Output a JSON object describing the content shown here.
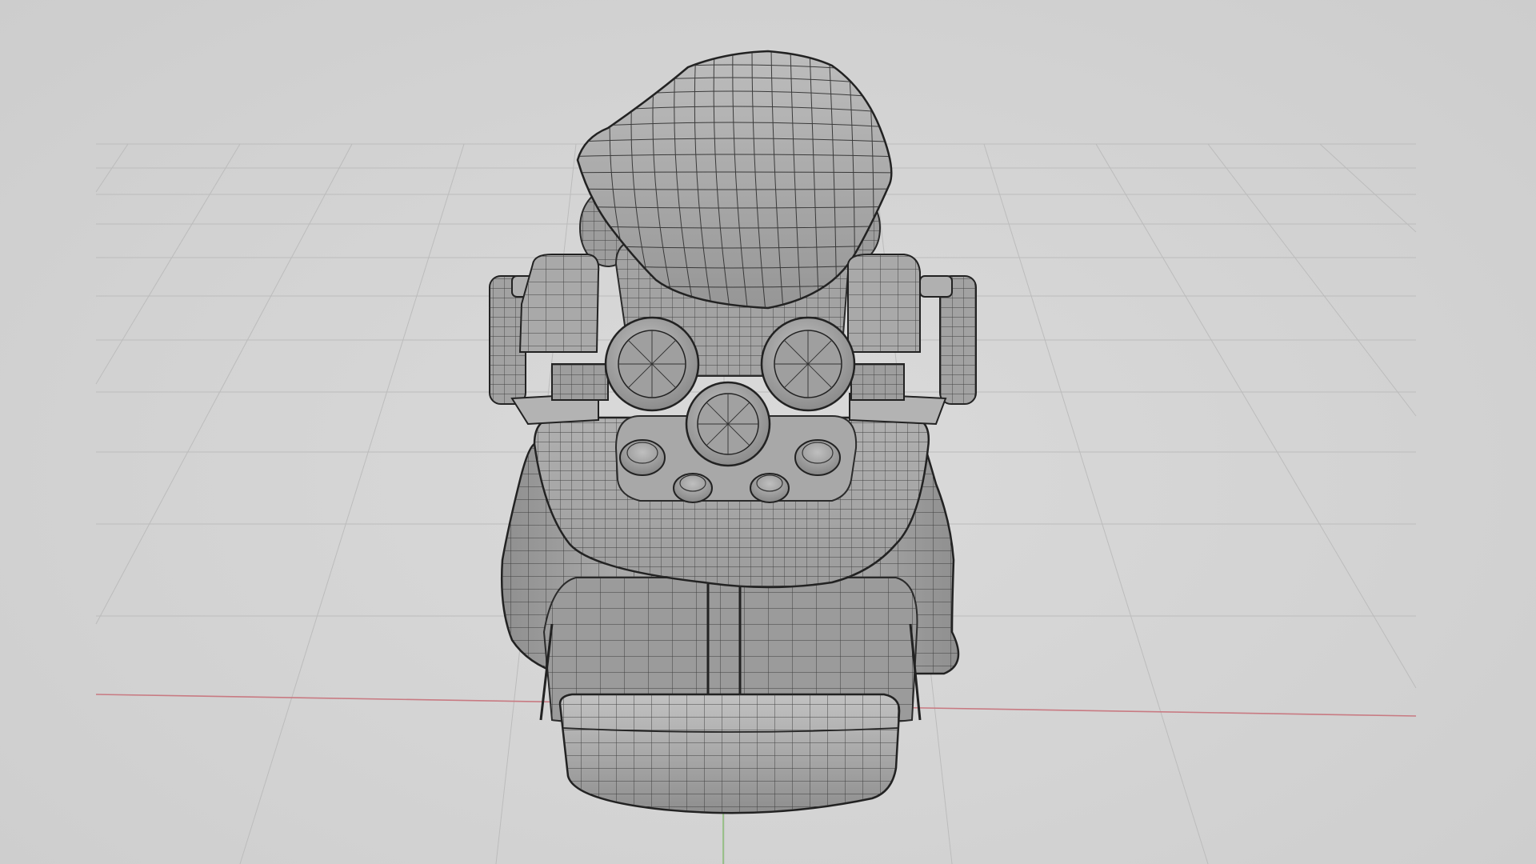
{
  "viewport": {
    "mode": "3d-modeling-viewport",
    "shading": "solid-with-wireframe",
    "background_color": "#d3d3d3",
    "grid_line_color": "#b9b9b9",
    "x_axis_color": "#c87a82",
    "y_axis_color": "#8fbf7a"
  },
  "model": {
    "subject": "vehicle-cockpit-mesh",
    "surface_color": "#a6a6a6",
    "wire_color": "#2b2b2b",
    "parts": [
      "windshield",
      "body-shell",
      "front-bumper",
      "handlebar-left",
      "handlebar-right",
      "gauge-left",
      "gauge-right",
      "gauge-center",
      "knobs"
    ]
  }
}
